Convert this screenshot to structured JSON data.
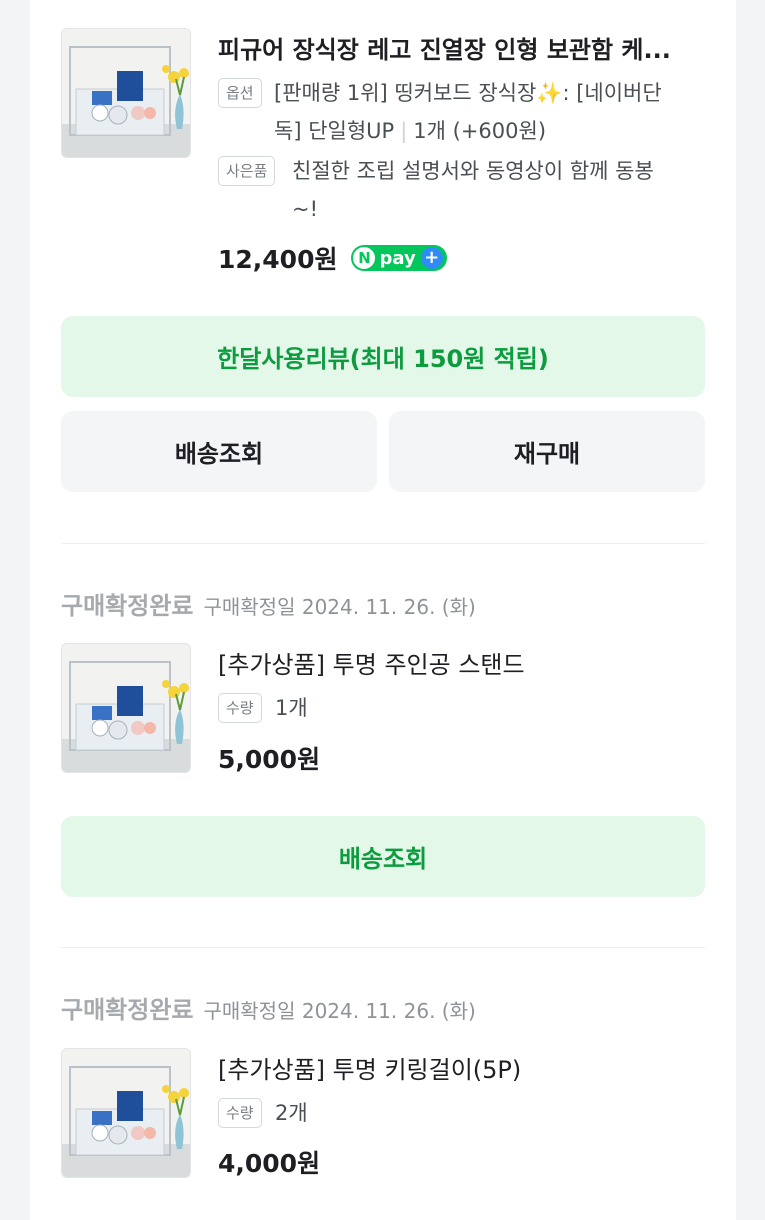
{
  "items": [
    {
      "title": "피규어 장식장 레고 진열장 인형 보관함 케...",
      "option_tag": "옵션",
      "option_line1": "[판매량 1위] 띵커보드 장식장✨: [네이버단",
      "option_line2": "독] 단일형UP",
      "option_qty": "1개 (+600원)",
      "gift_tag": "사은품",
      "gift_line1": "친절한 조립 설명서와 동영상이 함께 동봉",
      "gift_line2": "~!",
      "price": "12,400원",
      "npay_label": "pay",
      "review_button": "한달사용리뷰(최대 150원 적립)",
      "track_button": "배송조회",
      "rebuy_button": "재구매"
    },
    {
      "status": "구매확정완료",
      "status_date": "구매확정일 2024. 11. 26. (화)",
      "title": "[추가상품] 투명 주인공 스탠드",
      "qty_tag": "수량",
      "qty": "1개",
      "price": "5,000원",
      "track_button": "배송조회"
    },
    {
      "status": "구매확정완료",
      "status_date": "구매확정일 2024. 11. 26. (화)",
      "title": "[추가상품] 투명 키링걸이(5P)",
      "qty_tag": "수량",
      "qty": "2개",
      "price": "4,000원"
    }
  ],
  "colors": {
    "accent_green": "#0c9b3f",
    "green_button_bg": "#e3f8e9",
    "npay_green": "#03c75a",
    "npay_plus_blue": "#2f8cf6"
  },
  "icons": [
    "product-thumbnail",
    "npay-logo",
    "plus-icon"
  ]
}
